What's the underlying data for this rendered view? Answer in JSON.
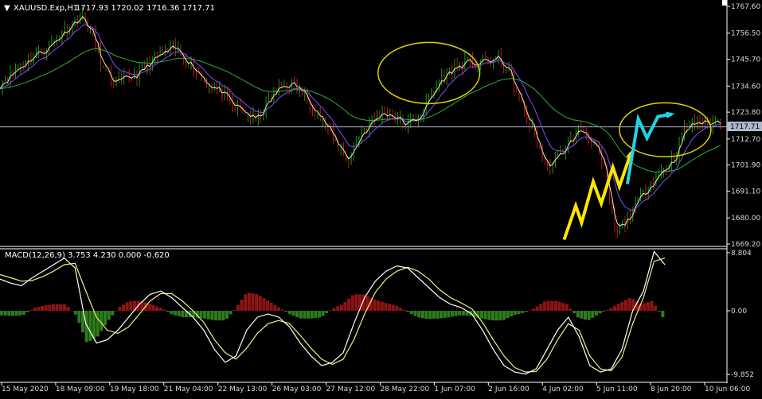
{
  "window": {
    "symbol_label": "XAUUSD.Exp,H1",
    "ohlc_label": "1717.93 1720.02 1716.36 1717.71",
    "current_price_label": "1717.71"
  },
  "colors": {
    "background": "#000000",
    "axis_line": "#ffffff",
    "candle_up": "#1a9a1a",
    "candle_down": "#b81c1c",
    "ma_fast": "#e9e9b0",
    "ma_mid": "#7d4cff",
    "ma_slow": "#2fae2f",
    "price_line": "#aeb8cc",
    "ellipse": "#d9d400",
    "arrow_yellow": "#ffe500",
    "arrow_cyan": "#24d2e6",
    "macd_line": "#ffffff",
    "signal_line": "#f0f08a",
    "hist_pos": "#8e1414",
    "hist_neg": "#2e7c1c"
  },
  "chart_data": [
    {
      "type": "line",
      "title": "XAUUSD.Exp,H1",
      "ylim": [
        1669.2,
        1767.6
      ],
      "y_ticks": [
        "1767.60",
        "1756.50",
        "1745.70",
        "1734.60",
        "1723.80",
        "1712.70",
        "1701.90",
        "1691.10",
        "1680.00",
        "1669.20"
      ],
      "x_ticks": [
        "15 May 2020",
        "18 May 09:00",
        "19 May 18:00",
        "21 May 04:00",
        "22 May 13:00",
        "26 May 03:00",
        "27 May 12:00",
        "28 May 22:00",
        "1 Jun 07:00",
        "2 Jun 16:00",
        "4 Jun 02:00",
        "5 Jun 11:00",
        "8 Jun 20:00",
        "10 Jun 06:00"
      ],
      "current_price": 1717.71,
      "ohlc": {
        "open": 1717.93,
        "high": 1720.02,
        "low": 1716.36,
        "close": 1717.71
      },
      "series": [
        {
          "values": [
            1736,
            1740,
            1744,
            1748,
            1750,
            1755,
            1760,
            1764,
            1755,
            1740,
            1735,
            1738,
            1740,
            1745,
            1748,
            1750,
            1746,
            1740,
            1735,
            1732,
            1726,
            1724,
            1720,
            1728,
            1734,
            1736,
            1732,
            1726,
            1718,
            1710,
            1704,
            1715,
            1720,
            1724,
            1722,
            1718,
            1722,
            1730,
            1738,
            1742,
            1744,
            1744,
            1745,
            1746,
            1738,
            1725,
            1715,
            1700,
            1705,
            1712,
            1717,
            1712,
            1700,
            1672,
            1680,
            1688,
            1695,
            1700,
            1705,
            1718,
            1720,
            1719,
            1720
          ]
        }
      ]
    },
    {
      "type": "bar",
      "title": "MACD(12,26,9) 3.753 4.230 0.000 -0.620",
      "ylim": [
        -9.852,
        8.804
      ],
      "y_ticks": [
        "8.804",
        "0.00",
        "-9.852"
      ],
      "series": [
        {
          "name": "MACD(12,26,9)",
          "values": [
            4.8,
            4.2,
            3.8,
            5.0,
            6.0,
            7.0,
            8.0,
            6.5,
            -2.0,
            -5.0,
            -4.5,
            -3.0,
            -1.0,
            1.0,
            2.5,
            3.0,
            2.0,
            0.5,
            -1.0,
            -3.0,
            -6.0,
            -8.0,
            -7.0,
            -3.0,
            -1.0,
            -0.5,
            -1.0,
            -2.5,
            -5.0,
            -7.0,
            -8.5,
            -8.0,
            -6.5,
            -2.0,
            2.0,
            4.5,
            6.0,
            6.8,
            6.5,
            5.0,
            3.5,
            2.0,
            1.0,
            0.5,
            -0.5,
            -3.0,
            -6.0,
            -8.5,
            -9.5,
            -9.8,
            -9.0,
            -6.0,
            -3.0,
            -1.0,
            -4.0,
            -8.5,
            -9.5,
            -9.0,
            -6.0,
            0.0,
            3.0,
            9.0,
            7.0
          ]
        },
        {
          "name": "signal",
          "values": [
            5.5,
            5.0,
            4.5,
            4.6,
            5.2,
            6.0,
            7.0,
            7.2,
            3.0,
            -1.0,
            -3.0,
            -3.5,
            -2.5,
            -0.5,
            1.5,
            2.6,
            2.6,
            1.5,
            0.0,
            -1.8,
            -4.5,
            -6.5,
            -7.5,
            -5.8,
            -3.5,
            -2.0,
            -1.5,
            -2.0,
            -3.8,
            -5.8,
            -7.5,
            -8.3,
            -7.5,
            -4.5,
            -0.5,
            2.8,
            4.8,
            6.0,
            6.6,
            6.0,
            4.8,
            3.2,
            2.0,
            1.2,
            0.3,
            -1.8,
            -4.5,
            -7.0,
            -8.8,
            -9.5,
            -9.4,
            -7.5,
            -4.5,
            -2.0,
            -3.0,
            -7.0,
            -9.0,
            -9.3,
            -7.2,
            -2.0,
            2.0,
            7.5,
            8.0
          ]
        }
      ]
    }
  ]
}
